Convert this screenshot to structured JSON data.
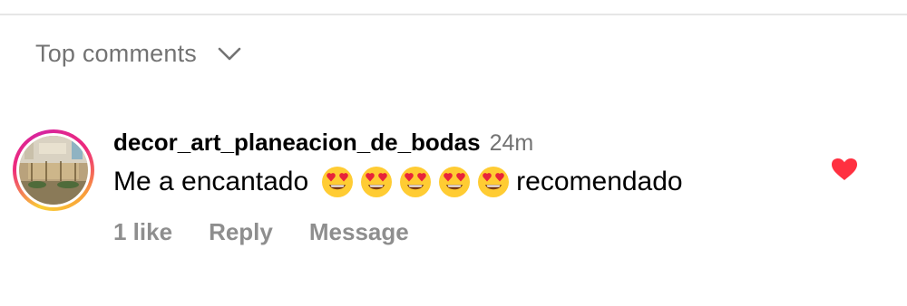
{
  "sort": {
    "label": "Top comments",
    "icon": "chevron-down-icon"
  },
  "comment": {
    "username": "decor_art_planeacion_de_bodas",
    "time": "24m",
    "text_before": "Me a encantado",
    "emojis": [
      "😍",
      "😍",
      "😍",
      "😍",
      "😍"
    ],
    "text_after": "recomendado",
    "likes": "1 like",
    "reply_label": "Reply",
    "message_label": "Message",
    "liked": true
  },
  "colors": {
    "heart": "#ff3040",
    "muted": "#737373",
    "action": "#8e8e8e"
  }
}
